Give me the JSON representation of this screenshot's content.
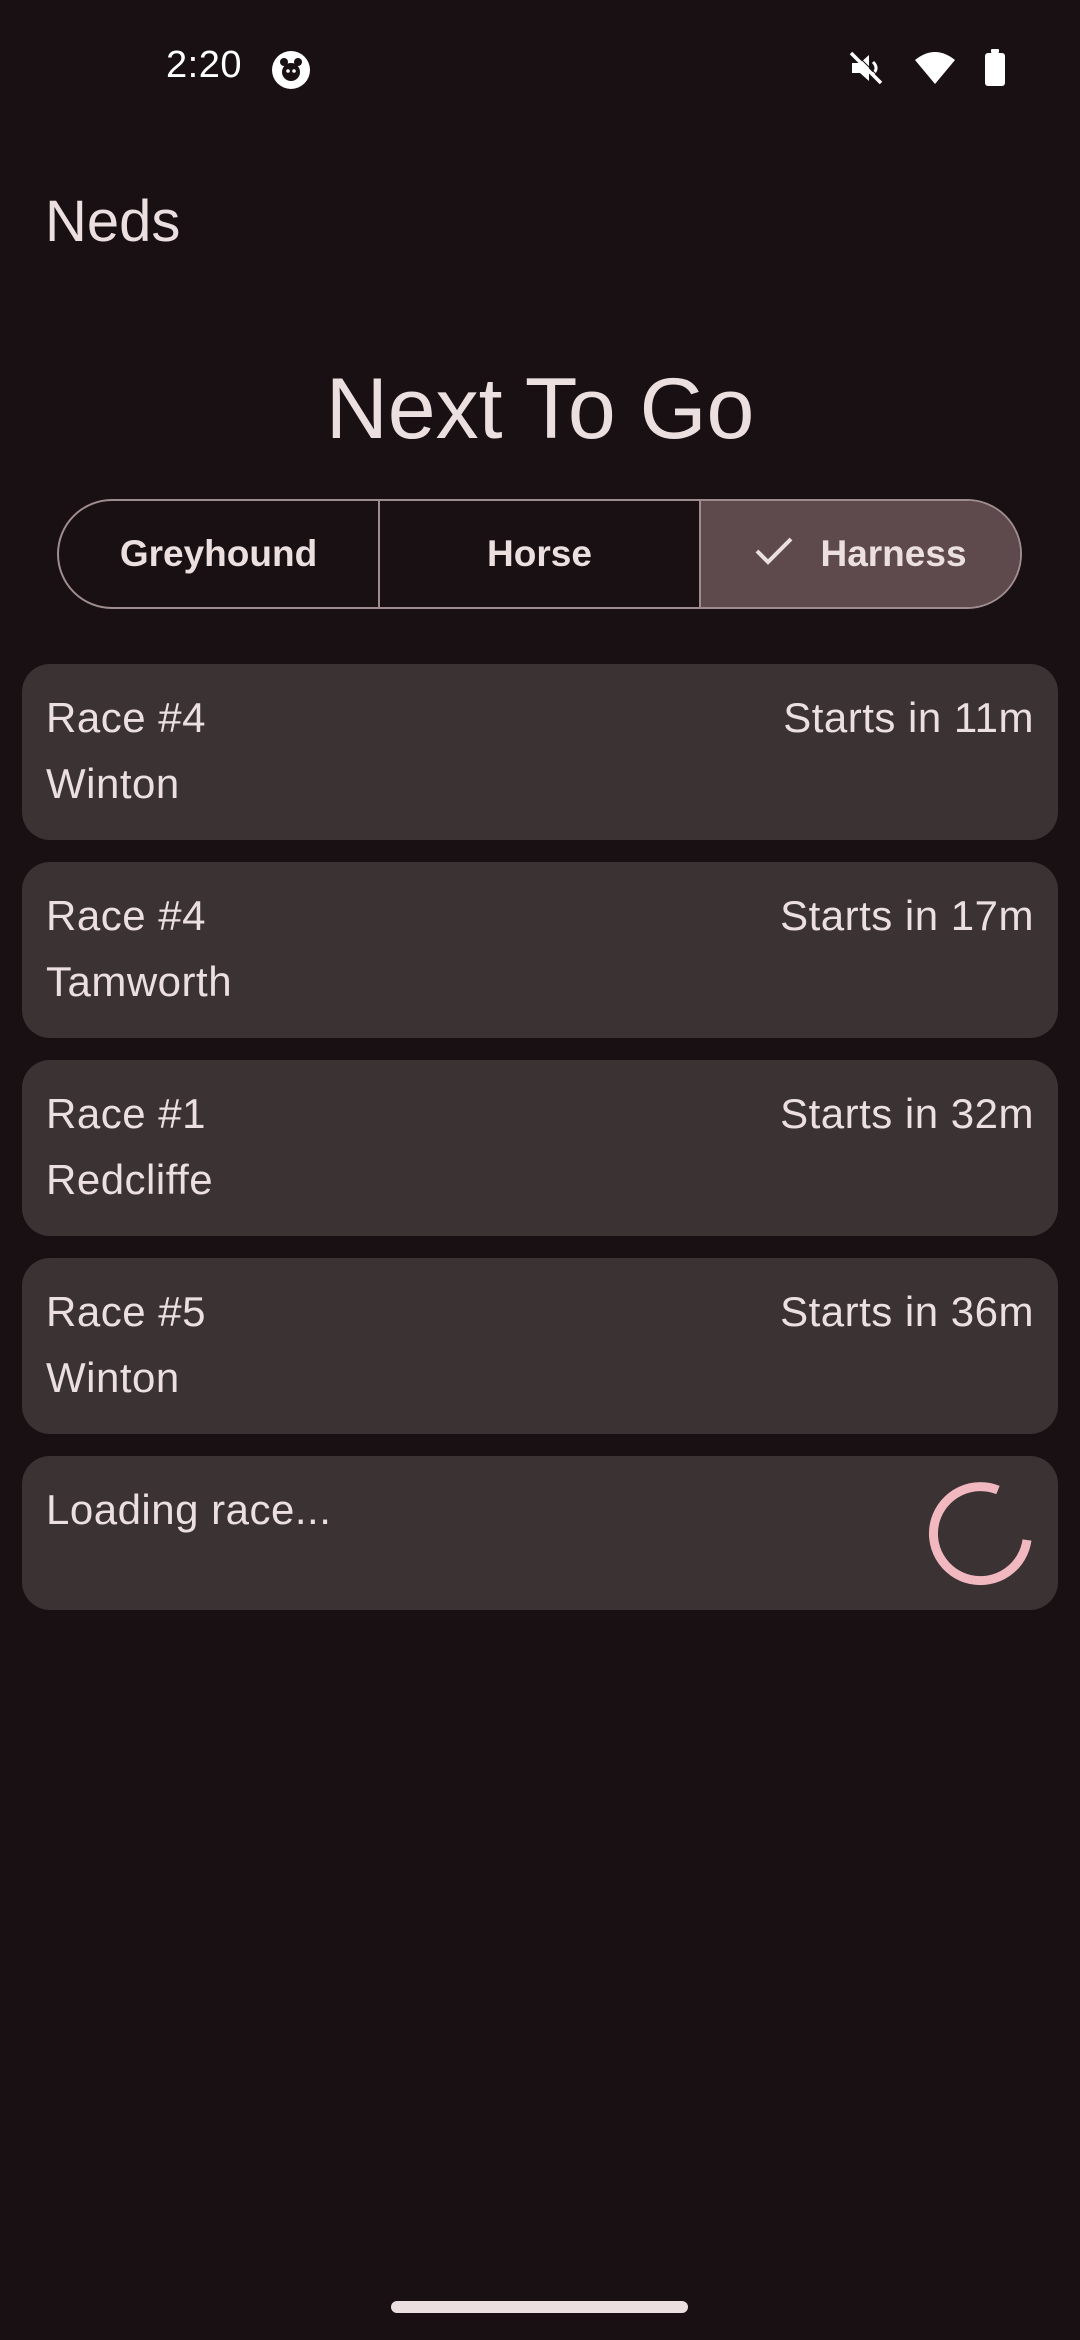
{
  "status_bar": {
    "time": "2:20",
    "icons": [
      "app-notification-icon",
      "mute-icon",
      "wifi-icon",
      "battery-icon"
    ]
  },
  "app_bar": {
    "title": "Neds"
  },
  "heading": "Next To Go",
  "filters": {
    "options": [
      {
        "label": "Greyhound",
        "selected": false
      },
      {
        "label": "Horse",
        "selected": false
      },
      {
        "label": "Harness",
        "selected": true
      }
    ]
  },
  "races": [
    {
      "number": "Race #4",
      "venue": "Winton",
      "starts": "Starts in 11m"
    },
    {
      "number": "Race #4",
      "venue": "Tamworth",
      "starts": "Starts in 17m"
    },
    {
      "number": "Race #1",
      "venue": "Redcliffe",
      "starts": "Starts in 32m"
    },
    {
      "number": "Race #5",
      "venue": "Winton",
      "starts": "Starts in 36m"
    }
  ],
  "loading": {
    "text": "Loading race..."
  },
  "colors": {
    "background": "#181012",
    "card": "#3a3233",
    "selected_segment": "#5e4a4c",
    "accent": "#f2b8c0",
    "text": "#ecdfe0"
  }
}
